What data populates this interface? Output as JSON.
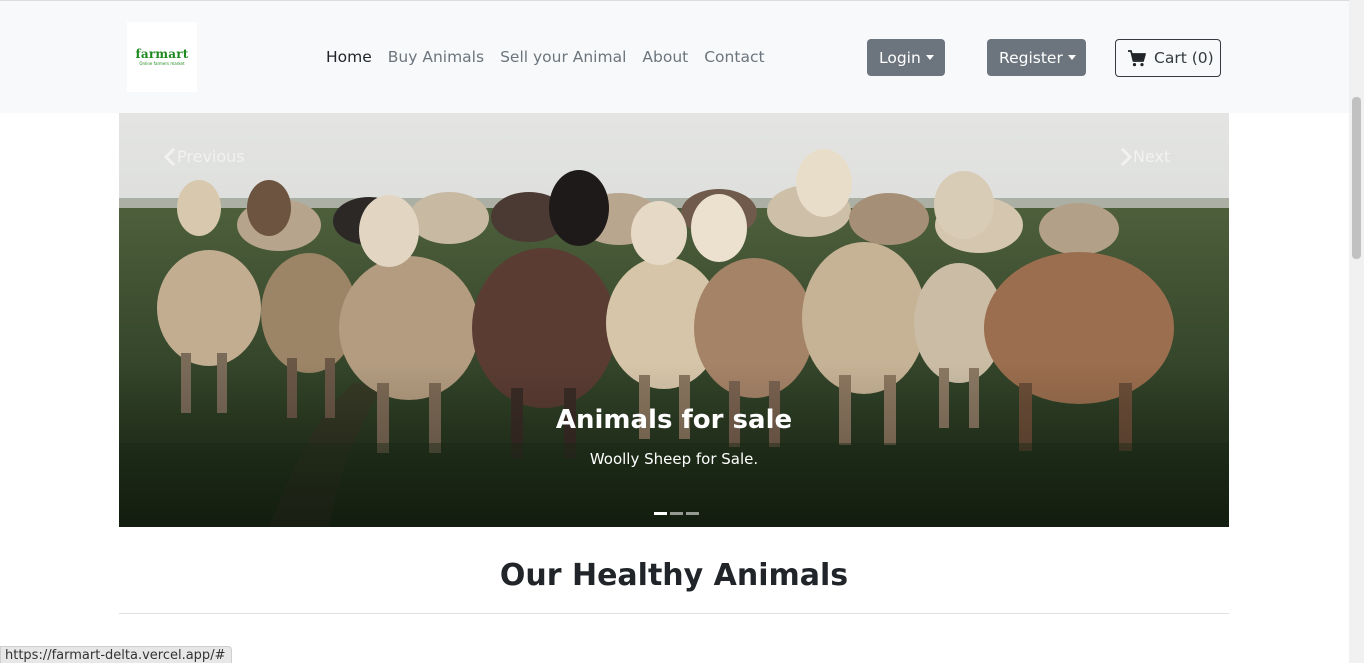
{
  "navbar": {
    "logo_text": "farmart",
    "logo_tagline": "Online farmers market",
    "links": [
      {
        "label": "Home",
        "active": true
      },
      {
        "label": "Buy Animals"
      },
      {
        "label": "Sell your Animal"
      },
      {
        "label": "About"
      },
      {
        "label": "Contact"
      }
    ],
    "login_label": "Login",
    "register_label": "Register",
    "cart_label": "Cart (0)",
    "cart_icon": "cart-icon"
  },
  "carousel": {
    "prev_label": "Previous",
    "next_label": "Next",
    "caption_title": "Animals for sale",
    "caption_text": "Woolly Sheep for Sale.",
    "indicator_count": 3,
    "active_index": 0
  },
  "section": {
    "title": "Our Healthy Animals"
  },
  "status_bar": {
    "url": "https://farmart-delta.vercel.app/#"
  },
  "colors": {
    "navbar_bg": "#f8f9fa",
    "button_secondary": "#6c757d",
    "brand_green": "#1e8a1e"
  }
}
